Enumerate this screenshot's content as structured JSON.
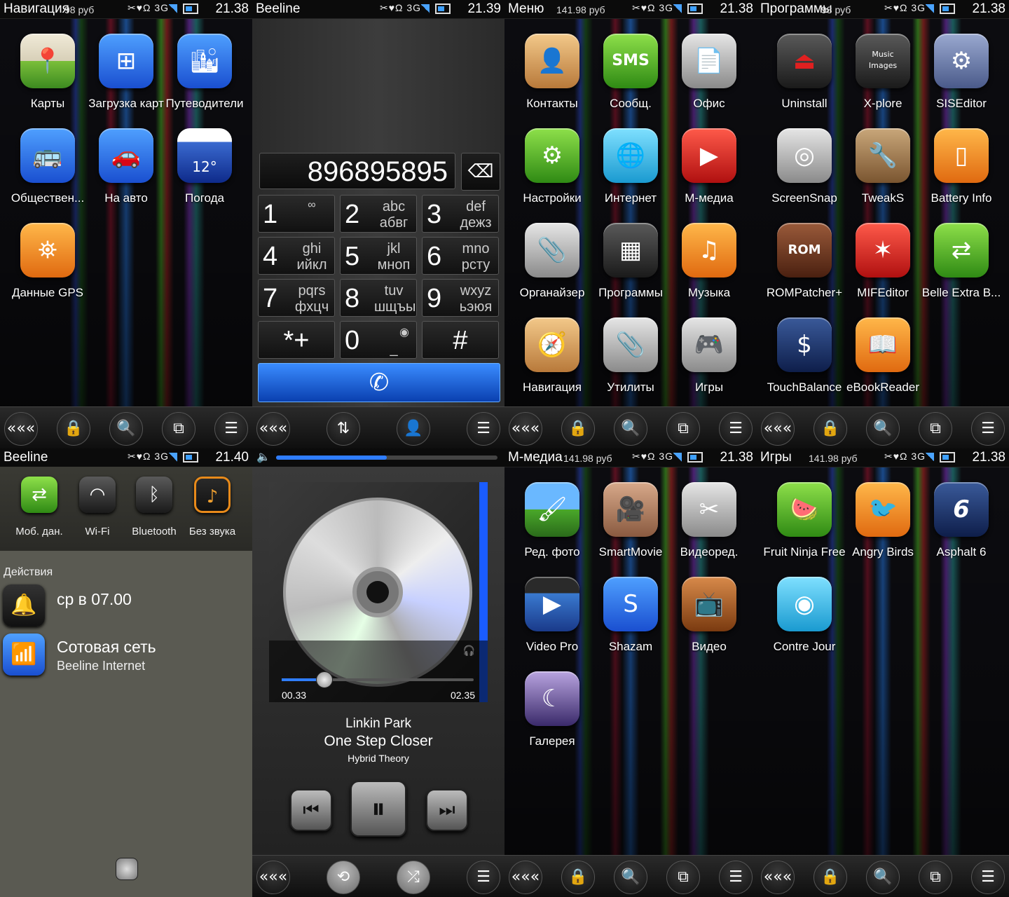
{
  "panels": {
    "nav": {
      "title": "Навигация",
      "credit": "98 руб",
      "time": "21.38",
      "apps": [
        "Карты",
        "Загрузка карт",
        "Путеводители",
        "Обществен...",
        "На авто",
        "Погода",
        "Данные GPS"
      ],
      "weather_badge": "12°"
    },
    "dialer": {
      "title": "Beeline",
      "time": "21.39",
      "number": "896895895",
      "keys": [
        {
          "d": "1",
          "l1": "",
          "l2": ""
        },
        {
          "d": "2",
          "l1": "abc",
          "l2": "абвг"
        },
        {
          "d": "3",
          "l1": "def",
          "l2": "дежз"
        },
        {
          "d": "4",
          "l1": "ghi",
          "l2": "ийкл"
        },
        {
          "d": "5",
          "l1": "jkl",
          "l2": "мноп"
        },
        {
          "d": "6",
          "l1": "mno",
          "l2": "рсту"
        },
        {
          "d": "7",
          "l1": "pqrs",
          "l2": "фхцч"
        },
        {
          "d": "8",
          "l1": "tuv",
          "l2": "шщъы"
        },
        {
          "d": "9",
          "l1": "wxyz",
          "l2": "ьэюя"
        },
        {
          "d": "*+",
          "l1": "",
          "l2": ""
        },
        {
          "d": "0",
          "l1": "",
          "l2": "_"
        },
        {
          "d": "#",
          "l1": "",
          "l2": ""
        }
      ]
    },
    "menu": {
      "title": "Меню",
      "credit": "141.98 руб",
      "time": "21.38",
      "apps": [
        "Контакты",
        "Сообщ.",
        "Офис",
        "Настройки",
        "Интернет",
        "М-медиа",
        "Органайзер",
        "Программы",
        "Музыка",
        "Навигация",
        "Утилиты",
        "Игры"
      ],
      "sms_text": "SMS"
    },
    "programs": {
      "title": "Программы",
      "credit": "98 руб",
      "time": "21.38",
      "apps": [
        "Uninstall",
        "X-plore",
        "SISEditor",
        "ScreenSnap",
        "TweakS",
        "Battery Info",
        "ROMPatcher+",
        "MIFEditor",
        "Belle Extra B...",
        "TouchBalance",
        "eBookReader"
      ],
      "xplore_lines": [
        "Music",
        "Images"
      ],
      "rom_text": "ROM"
    },
    "quick": {
      "title": "Beeline",
      "time": "21.40",
      "toggles": [
        "Моб. дан.",
        "Wi-Fi",
        "Bluetooth",
        "Без звука"
      ],
      "section": "Действия",
      "alarm": "ср в 07.00",
      "network_title": "Сотовая сеть",
      "network_sub": "Beeline Internet"
    },
    "music": {
      "progress": 0.5,
      "seek": 0.22,
      "elapsed": "00.33",
      "total": "02.35",
      "artist": "Linkin Park",
      "track": "One Step Closer",
      "album": "Hybrid Theory"
    },
    "mmedia": {
      "title": "М-медиа",
      "credit": "141.98 руб",
      "time": "21.38",
      "apps": [
        "Ред. фото",
        "SmartMovie",
        "Видеоред.",
        "Video Pro",
        "Shazam",
        "Видео",
        "Галерея"
      ]
    },
    "games": {
      "title": "Игры",
      "credit": "141.98 руб",
      "time": "21.38",
      "apps": [
        "Fruit Ninja Free",
        "Angry Birds",
        "Asphalt 6",
        "Contre Jour"
      ],
      "asphalt_badge": "6"
    }
  },
  "status_icons": "✂♥Ω 3G",
  "dock": {
    "back": "«««",
    "lock": "🔒",
    "search": "🔍",
    "switch": "⧉",
    "menu": "☰",
    "swap": "⇅",
    "contacts": "👤",
    "repeat": "⟲",
    "shuffle": "⤮"
  }
}
